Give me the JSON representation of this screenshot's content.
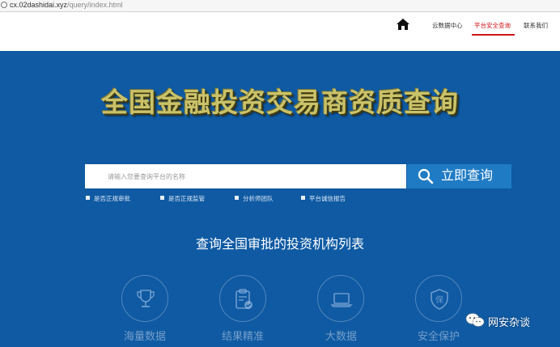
{
  "browser": {
    "url_host": "cx.02dashidai.xyz",
    "url_path": "/query/index.html"
  },
  "nav": {
    "home_icon": "home-icon",
    "items": [
      "云数据中心",
      "平台安全查询",
      "联系我们"
    ],
    "active_index": 1,
    "active_color": "#d0161b"
  },
  "hero": {
    "title": "全国金融投资交易商资质查询"
  },
  "search": {
    "placeholder": "请输入您要查询平台的名称",
    "button_label": "立即查询",
    "button_icon": "search-icon"
  },
  "tags": [
    "是否正规审批",
    "是否正规监管",
    "分析师团队",
    "平台诚信报告"
  ],
  "section": {
    "title": "查询全国审批的投资机构列表"
  },
  "features": [
    {
      "icon": "trophy-icon",
      "label": "海量数据"
    },
    {
      "icon": "clipboard-check-icon",
      "label": "结果精准"
    },
    {
      "icon": "laptop-icon",
      "label": "大数据"
    },
    {
      "icon": "shield-icon",
      "label": "安全保护",
      "icon_text": "保"
    }
  ],
  "watermark": {
    "text": "网安杂谈",
    "icon": "wechat-icon"
  },
  "colors": {
    "background": "#0f5aa3",
    "button": "#1f7bc4",
    "title_gold": "#c9c26a"
  }
}
